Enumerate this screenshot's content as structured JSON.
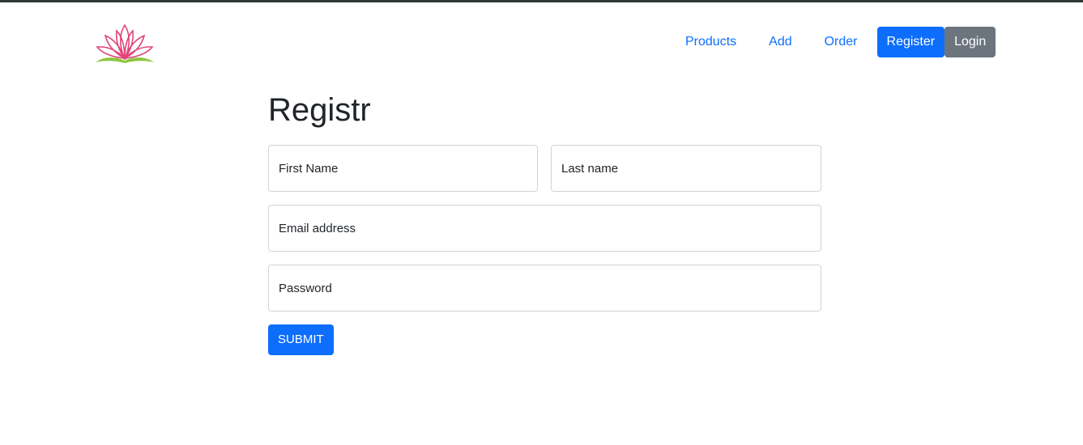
{
  "brand": {
    "logo_icon": "lotus-logo-icon",
    "colors": {
      "petals": "#e0457b",
      "leaves": "#8cc63f"
    }
  },
  "nav": {
    "links": [
      "Products",
      "Add",
      "Order"
    ],
    "register_label": "Register",
    "login_label": "Login"
  },
  "form": {
    "title": "Registr",
    "first_name_placeholder": "First Name",
    "last_name_placeholder": "Last name",
    "email_placeholder": "Email address",
    "password_placeholder": "Password",
    "submit_label": "SUBMIT"
  },
  "colors": {
    "primary": "#0d6efd",
    "secondary": "#6c757d",
    "top_border": "#2f3a32"
  }
}
